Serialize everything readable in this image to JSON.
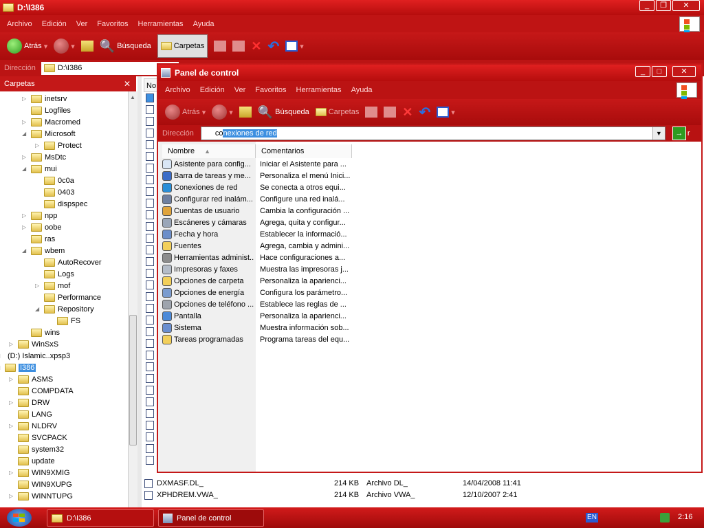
{
  "bg_window": {
    "title": "D:\\I386",
    "menu": [
      "Archivo",
      "Edición",
      "Ver",
      "Favoritos",
      "Herramientas",
      "Ayuda"
    ],
    "toolbar": {
      "back": "Atrás",
      "search": "Búsqueda",
      "folders": "Carpetas"
    },
    "address_label": "Dirección",
    "address_value": "D:\\I386",
    "folders_pane_title": "Carpetas",
    "column_header_fragment": "No",
    "tree": [
      {
        "label": "inetsrv",
        "level": 2,
        "tri": "collapsed"
      },
      {
        "label": "Logfiles",
        "level": 2,
        "tri": "none"
      },
      {
        "label": "Macromed",
        "level": 2,
        "tri": "collapsed"
      },
      {
        "label": "Microsoft",
        "level": 2,
        "tri": "expanded"
      },
      {
        "label": "Protect",
        "level": 3,
        "tri": "collapsed"
      },
      {
        "label": "MsDtc",
        "level": 2,
        "tri": "collapsed"
      },
      {
        "label": "mui",
        "level": 2,
        "tri": "expanded"
      },
      {
        "label": "0c0a",
        "level": 3,
        "tri": "none"
      },
      {
        "label": "0403",
        "level": 3,
        "tri": "none"
      },
      {
        "label": "dispspec",
        "level": 3,
        "tri": "none"
      },
      {
        "label": "npp",
        "level": 2,
        "tri": "collapsed"
      },
      {
        "label": "oobe",
        "level": 2,
        "tri": "collapsed"
      },
      {
        "label": "ras",
        "level": 2,
        "tri": "none"
      },
      {
        "label": "wbem",
        "level": 2,
        "tri": "expanded"
      },
      {
        "label": "AutoRecover",
        "level": 3,
        "tri": "none"
      },
      {
        "label": "Logs",
        "level": 3,
        "tri": "none"
      },
      {
        "label": "mof",
        "level": 3,
        "tri": "collapsed"
      },
      {
        "label": "Performance",
        "level": 3,
        "tri": "none"
      },
      {
        "label": "Repository",
        "level": 3,
        "tri": "expanded"
      },
      {
        "label": "FS",
        "level": 4,
        "tri": "none"
      },
      {
        "label": "wins",
        "level": 2,
        "tri": "none"
      },
      {
        "label": "WinSxS",
        "level": 1,
        "tri": "collapsed"
      },
      {
        "label": "(D:) Islamic..xpsp3",
        "level": 0,
        "tri": "expanded",
        "drive": true
      },
      {
        "label": "I386",
        "level": 0,
        "tri": "expanded",
        "selected": true
      },
      {
        "label": "ASMS",
        "level": 1,
        "tri": "collapsed"
      },
      {
        "label": "COMPDATA",
        "level": 1,
        "tri": "none"
      },
      {
        "label": "DRW",
        "level": 1,
        "tri": "collapsed"
      },
      {
        "label": "LANG",
        "level": 1,
        "tri": "none"
      },
      {
        "label": "NLDRV",
        "level": 1,
        "tri": "collapsed"
      },
      {
        "label": "SVCPACK",
        "level": 1,
        "tri": "none"
      },
      {
        "label": "system32",
        "level": 1,
        "tri": "none"
      },
      {
        "label": "update",
        "level": 1,
        "tri": "none"
      },
      {
        "label": "WIN9XMIG",
        "level": 1,
        "tri": "collapsed"
      },
      {
        "label": "WIN9XUPG",
        "level": 1,
        "tri": "none"
      },
      {
        "label": "WINNTUPG",
        "level": 1,
        "tri": "collapsed"
      }
    ],
    "files": [
      {
        "name": "XPHDREM.VWA_",
        "size": "214 KB",
        "type": "Archivo VWA_",
        "date": "12/10/2007 2:41"
      },
      {
        "name": "DXMASF.DL_",
        "size": "214 KB",
        "type": "Archivo DL_",
        "date": "14/04/2008 11:41"
      }
    ]
  },
  "cp_window": {
    "title": "Panel de control",
    "menu": [
      "Archivo",
      "Edición",
      "Ver",
      "Favoritos",
      "Herramientas",
      "Ayuda"
    ],
    "toolbar": {
      "back": "Atrás",
      "search": "Búsqueda",
      "folders": "Carpetas"
    },
    "address_label": "Dirección",
    "address_prefix": "co",
    "address_selected": "nexiones de red",
    "go_fragment": "r",
    "columns": {
      "name": "Nombre",
      "comments": "Comentarios"
    },
    "items": [
      {
        "name": "Asistente para config...",
        "desc": "Iniciar el Asistente para ...",
        "color": "#d9e6f5"
      },
      {
        "name": "Barra de tareas y me...",
        "desc": "Personaliza el menú Inici...",
        "color": "#3b6cc7"
      },
      {
        "name": "Conexiones de red",
        "desc": "Se conecta a otros equi...",
        "color": "#2a8fd8"
      },
      {
        "name": "Configurar red inalám...",
        "desc": "Configure una red inalá...",
        "color": "#6e7fa0"
      },
      {
        "name": "Cuentas de usuario",
        "desc": "Cambia la configuración ...",
        "color": "#e0a43c"
      },
      {
        "name": "Escáneres y cámaras",
        "desc": "Agrega, quita y configur...",
        "color": "#9aa6b8"
      },
      {
        "name": "Fecha y hora",
        "desc": "Establecer la informació...",
        "color": "#6c8ec9"
      },
      {
        "name": "Fuentes",
        "desc": "Agrega, cambia y admini...",
        "color": "#f2cf5a"
      },
      {
        "name": "Herramientas administ...",
        "desc": "Hace configuraciones a...",
        "color": "#8d8d8d"
      },
      {
        "name": "Impresoras y faxes",
        "desc": "Muestra las impresoras j...",
        "color": "#b4bcc8"
      },
      {
        "name": "Opciones de carpeta",
        "desc": "Personaliza la aparienci...",
        "color": "#f2cf5a"
      },
      {
        "name": "Opciones de energía",
        "desc": "Configura los parámetro...",
        "color": "#7b9ccf"
      },
      {
        "name": "Opciones de teléfono ...",
        "desc": "Establece las reglas de ...",
        "color": "#9ea4ad"
      },
      {
        "name": "Pantalla",
        "desc": "Personaliza la aparienci...",
        "color": "#4c8ad8"
      },
      {
        "name": "Sistema",
        "desc": "Muestra información sob...",
        "color": "#6a8fd0"
      },
      {
        "name": "Tareas programadas",
        "desc": "Programa tareas del equ...",
        "color": "#f2cf5a"
      }
    ]
  },
  "taskbar": {
    "tasks": [
      "D:\\I386",
      "Panel de control"
    ],
    "lang": "EN",
    "clock": "2:16"
  },
  "colors": {
    "accent": "#c41818",
    "selection": "#3d8fe0"
  }
}
